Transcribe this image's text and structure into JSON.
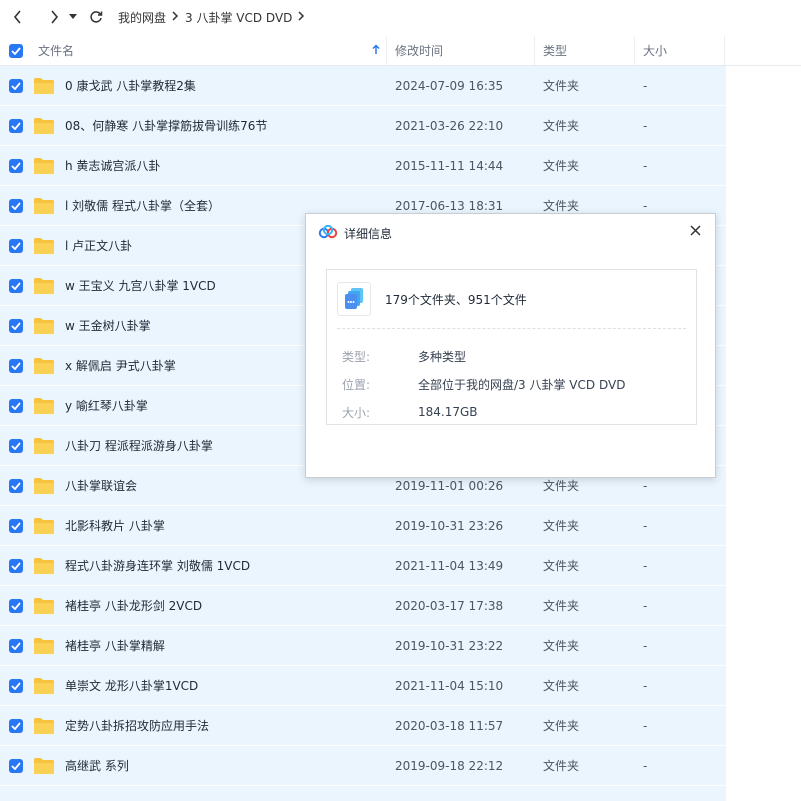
{
  "nav": {
    "back_icon": "chevron-left-icon",
    "forward_icon": "chevron-right-icon",
    "history_icon": "caret-down-icon",
    "refresh_icon": "refresh-icon",
    "breadcrumbs": [
      "我的网盘",
      "3 八卦掌 VCD DVD"
    ]
  },
  "table": {
    "columns": {
      "name": "文件名",
      "time": "修改时间",
      "type": "类型",
      "size": "大小"
    },
    "sort_icon": "arrow-up-icon",
    "rows": [
      {
        "name": "0 康戈武 八卦掌教程2集",
        "time": "2024-07-09 16:35",
        "type": "文件夹",
        "size": "-"
      },
      {
        "name": "08、何静寒 八卦掌撑筋拔骨训练76节",
        "time": "2021-03-26 22:10",
        "type": "文件夹",
        "size": "-"
      },
      {
        "name": "h 黄志诚宫派八卦",
        "time": "2015-11-11 14:44",
        "type": "文件夹",
        "size": "-"
      },
      {
        "name": "l 刘敬儒 程式八卦掌（全套）",
        "time": "2017-06-13 18:31",
        "type": "文件夹",
        "size": "-"
      },
      {
        "name": "l 卢正文八卦",
        "time": "",
        "type": "",
        "size": ""
      },
      {
        "name": "w 王宝义 九宫八卦掌 1VCD",
        "time": "",
        "type": "",
        "size": ""
      },
      {
        "name": "w 王金树八卦掌",
        "time": "",
        "type": "",
        "size": ""
      },
      {
        "name": "x 解佩启 尹式八卦掌",
        "time": "",
        "type": "",
        "size": ""
      },
      {
        "name": "y 喻红琴八卦掌",
        "time": "",
        "type": "",
        "size": ""
      },
      {
        "name": "八卦刀 程派程派游身八卦掌",
        "time": "",
        "type": "",
        "size": ""
      },
      {
        "name": "八卦掌联谊会",
        "time": "2019-11-01 00:26",
        "type": "文件夹",
        "size": "-"
      },
      {
        "name": "北影科教片  八卦掌",
        "time": "2019-10-31 23:26",
        "type": "文件夹",
        "size": "-"
      },
      {
        "name": "程式八卦游身连环掌  刘敬儒 1VCD",
        "time": "2021-11-04 13:49",
        "type": "文件夹",
        "size": "-"
      },
      {
        "name": "褚桂亭  八卦龙形剑 2VCD",
        "time": "2020-03-17 17:38",
        "type": "文件夹",
        "size": "-"
      },
      {
        "name": "褚桂亭  八卦掌精解",
        "time": "2019-10-31 23:22",
        "type": "文件夹",
        "size": "-"
      },
      {
        "name": "单崇文 龙形八卦掌1VCD",
        "time": "2021-11-04 15:10",
        "type": "文件夹",
        "size": "-"
      },
      {
        "name": "定势八卦拆招攻防应用手法",
        "time": "2020-03-18 11:57",
        "type": "文件夹",
        "size": "-"
      },
      {
        "name": "高继武 系列",
        "time": "2019-09-18 22:12",
        "type": "文件夹",
        "size": "-"
      }
    ]
  },
  "dialog": {
    "title": "详细信息",
    "app_icon": "cloud-logo-icon",
    "close_icon": "close-icon",
    "file_icon": "multi-file-icon",
    "summary": "179个文件夹、951个文件",
    "type_label": "类型:",
    "type_value": "多种类型",
    "location_label": "位置:",
    "location_value": "全部位于我的网盘/3 八卦掌 VCD DVD",
    "size_label": "大小:",
    "size_value": "184.17GB"
  },
  "colors": {
    "accent": "#2878f5",
    "row_selected": "#eaf5fe",
    "folder": "#f7c33c"
  }
}
